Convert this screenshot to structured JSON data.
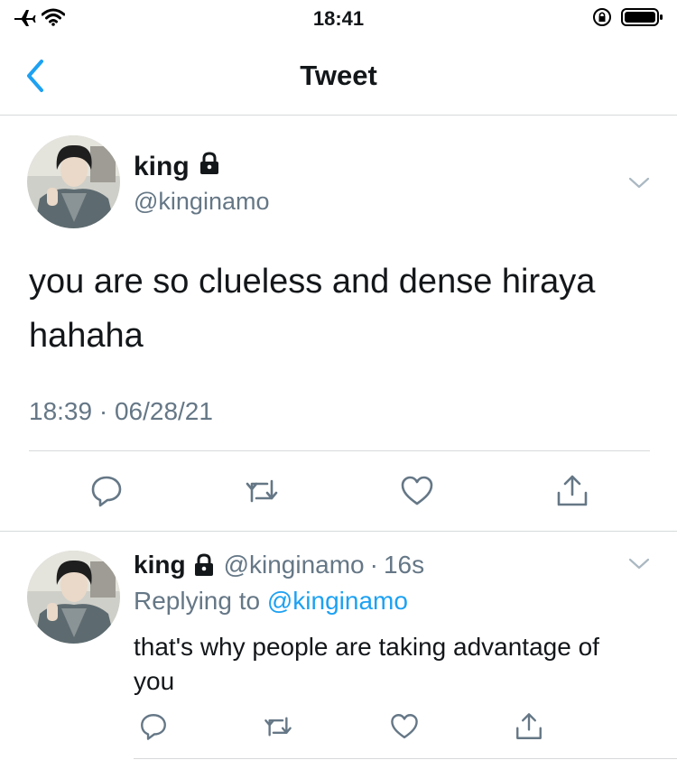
{
  "status": {
    "time": "18:41"
  },
  "nav": {
    "title": "Tweet"
  },
  "tweet": {
    "name": "king",
    "handle": "@kinginamo",
    "text": "you are so clueless and dense hiraya hahaha",
    "timestamp": "18:39 · 06/28/21"
  },
  "reply": {
    "name": "king",
    "handle": "@kinginamo",
    "time": "16s",
    "replying_prefix": "Replying to ",
    "replying_to": "@kinginamo",
    "text": "that's why people are taking advantage of you"
  },
  "colors": {
    "accent": "#1da1f2",
    "muted": "#657786",
    "icon": "#657786",
    "text": "#14171a",
    "divider": "#d6d9db"
  },
  "icons": [
    "airplane-icon",
    "wifi-icon",
    "orientation-lock-icon",
    "battery-icon",
    "back-chevron-icon",
    "lock-icon",
    "chevron-down-icon",
    "reply-icon",
    "retweet-icon",
    "like-icon",
    "share-icon"
  ]
}
